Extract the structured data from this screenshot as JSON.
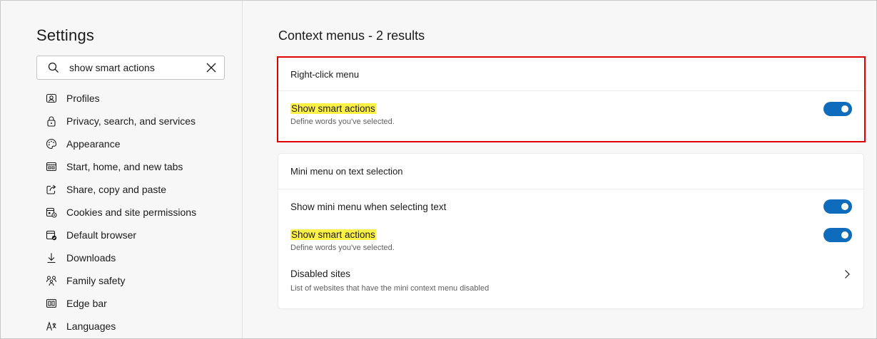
{
  "sidebar": {
    "title": "Settings",
    "search": {
      "value": "show smart actions",
      "placeholder": "Search settings"
    },
    "items": [
      {
        "label": "Profiles",
        "icon": "profile-icon"
      },
      {
        "label": "Privacy, search, and services",
        "icon": "lock-icon"
      },
      {
        "label": "Appearance",
        "icon": "palette-icon"
      },
      {
        "label": "Start, home, and new tabs",
        "icon": "start-page-icon"
      },
      {
        "label": "Share, copy and paste",
        "icon": "share-icon"
      },
      {
        "label": "Cookies and site permissions",
        "icon": "cookies-icon"
      },
      {
        "label": "Default browser",
        "icon": "browser-icon"
      },
      {
        "label": "Downloads",
        "icon": "download-icon"
      },
      {
        "label": "Family safety",
        "icon": "family-icon"
      },
      {
        "label": "Edge bar",
        "icon": "edge-bar-icon"
      },
      {
        "label": "Languages",
        "icon": "languages-icon"
      }
    ]
  },
  "main": {
    "title": "Context menus - 2 results",
    "right_click_card": {
      "header": "Right-click menu",
      "smart_actions": {
        "title": "Show smart actions",
        "desc": "Define words you've selected.",
        "enabled": true
      }
    },
    "mini_menu_card": {
      "header": "Mini menu on text selection",
      "show_mini_menu": {
        "title": "Show mini menu when selecting text",
        "enabled": true
      },
      "smart_actions": {
        "title": "Show smart actions",
        "desc": "Define words you've selected.",
        "enabled": true
      },
      "disabled_sites": {
        "title": "Disabled sites",
        "desc": "List of websites that have the mini context menu disabled"
      }
    }
  },
  "colors": {
    "accent": "#0f6cbd",
    "highlight": "#fff145",
    "annotation_frame": "#e00000"
  }
}
